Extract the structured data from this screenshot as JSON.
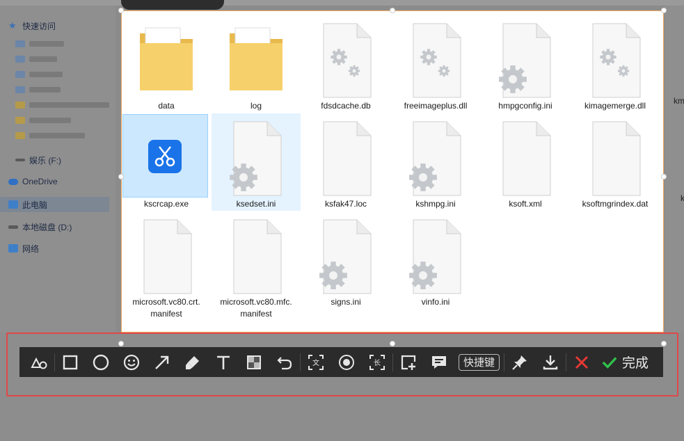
{
  "sidebar": {
    "quick_access": "快速访问",
    "media_drive": "娱乐 (F:)",
    "onedrive": "OneDrive",
    "this_pc": "此电脑",
    "local_disk": "本地磁盘 (D:)",
    "network": "网络"
  },
  "files": [
    {
      "name": "data",
      "icon": "folder-icon"
    },
    {
      "name": "log",
      "icon": "folder-icon"
    },
    {
      "name": "fdsdcache.db",
      "icon": "settings-file-icon"
    },
    {
      "name": "freeimageplus.dll",
      "icon": "settings-file-icon"
    },
    {
      "name": "hmpgconfig.ini",
      "icon": "config-file-icon"
    },
    {
      "name": "kimagemerge.dll",
      "icon": "settings-file-icon"
    },
    {
      "name": "kscrcap.exe",
      "icon": "scissors-app-icon"
    },
    {
      "name": "ksedset.ini",
      "icon": "config-file-icon"
    },
    {
      "name": "ksfak47.loc",
      "icon": "blank-file-icon"
    },
    {
      "name": "kshmpg.ini",
      "icon": "config-file-icon"
    },
    {
      "name": "ksoft.xml",
      "icon": "blank-file-icon"
    },
    {
      "name": "ksoftmgrindex.dat",
      "icon": "blank-file-icon"
    },
    {
      "name": "microsoft.vc80.crt.",
      "name2": "manifest",
      "icon": "blank-file-icon"
    },
    {
      "name": "microsoft.vc80.mfc.",
      "name2": "manifest",
      "icon": "blank-file-icon"
    },
    {
      "name": "signs.ini",
      "icon": "config-file-icon"
    },
    {
      "name": "vinfo.ini",
      "icon": "config-file-icon"
    }
  ],
  "clipped": {
    "right_top": "km",
    "right_mid": "k"
  },
  "toolbar": {
    "shortcut_label": "快捷键",
    "done_label": "完成",
    "tools": [
      "shapes-icon",
      "rectangle-icon",
      "ellipse-icon",
      "emoji-icon",
      "arrow-icon",
      "marker-icon",
      "text-icon",
      "mosaic-icon",
      "undo-icon",
      "ocr-icon",
      "record-icon",
      "long-screenshot-icon",
      "add-image-icon",
      "comment-icon",
      "pin-icon",
      "download-icon",
      "close-icon",
      "check-icon"
    ]
  },
  "colors": {
    "accent_green": "#2fc24b",
    "close_red": "#e53935",
    "selection_border": "#f0a860",
    "frame_red": "#e04848"
  }
}
